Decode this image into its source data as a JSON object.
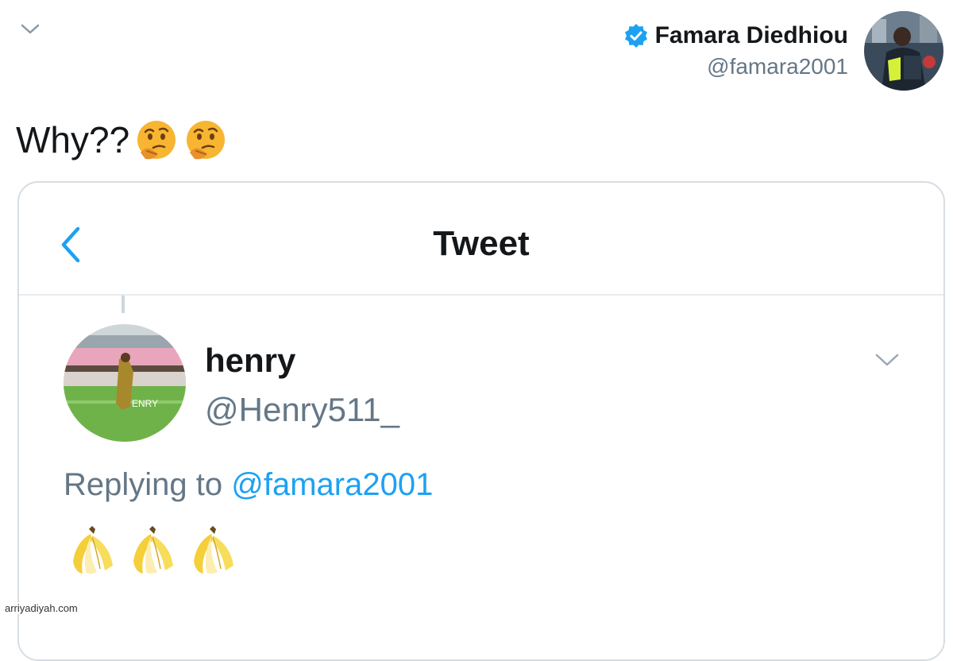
{
  "author": {
    "name": "Famara Diedhiou",
    "handle": "@famara2001",
    "verified": true,
    "avatar_icon": "player-avatar"
  },
  "tweet": {
    "text": "Why??",
    "emojis": [
      "thinking-face-icon",
      "thinking-face-icon"
    ]
  },
  "embedded": {
    "header_title": "Tweet",
    "back_icon": "chevron-left-icon",
    "reply": {
      "name": "henry",
      "handle": "@Henry511_",
      "replying_prefix": "Replying to",
      "replying_handle": "@famara2001",
      "emojis": [
        "banana-icon",
        "banana-icon",
        "banana-icon"
      ]
    }
  },
  "watermark": "arriyadiyah.com",
  "colors": {
    "twitter_blue": "#1da1f2",
    "secondary_text": "#657786",
    "primary_text": "#14171a",
    "border": "#d6dde3"
  }
}
